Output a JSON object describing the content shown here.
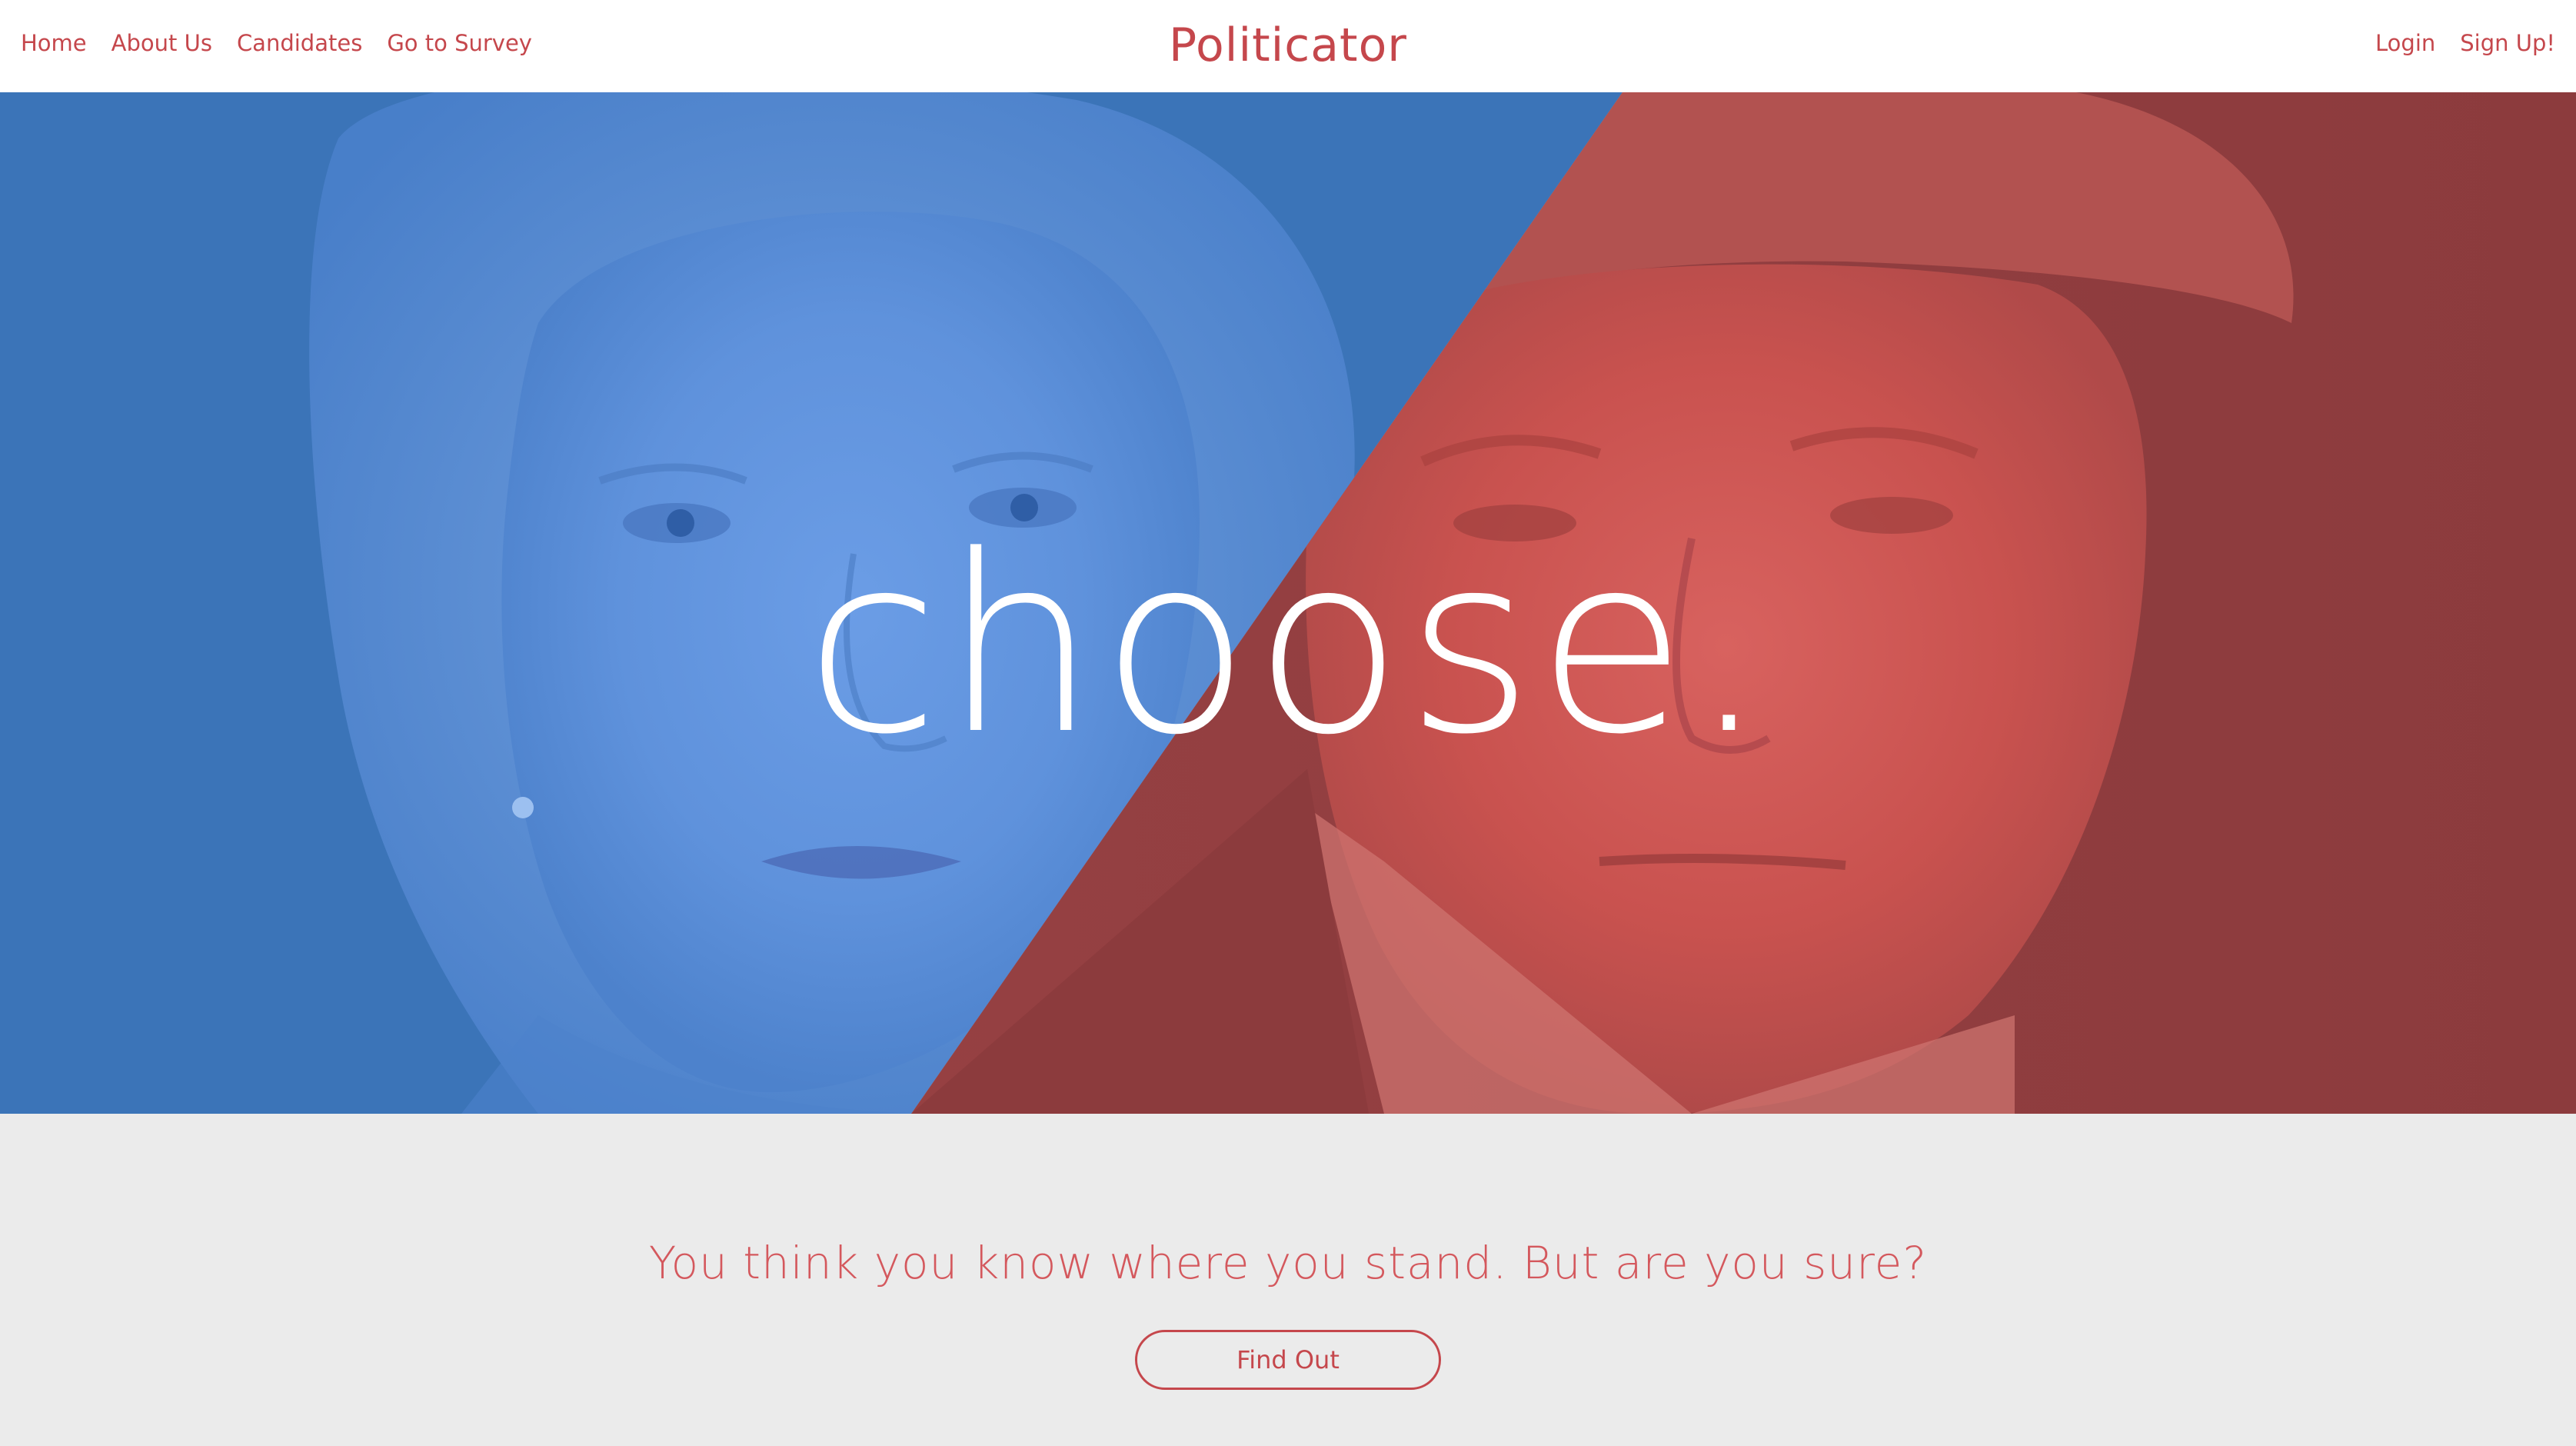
{
  "nav": {
    "left_links": [
      {
        "label": "Home"
      },
      {
        "label": "About Us"
      },
      {
        "label": "Candidates"
      },
      {
        "label": "Go to Survey"
      }
    ],
    "brand": "Politicator",
    "right_links": [
      {
        "label": "Login"
      },
      {
        "label": "Sign Up!"
      }
    ]
  },
  "hero": {
    "headline": "choose.",
    "left_panel": {
      "candidate": "Democratic candidate portrait",
      "tint": "#4a82cc"
    },
    "right_panel": {
      "candidate": "Republican candidate portrait",
      "tint": "#c9504f"
    }
  },
  "cta": {
    "tagline": "You think you know where you stand. But are you sure?",
    "button_label": "Find Out"
  },
  "colors": {
    "accent": "#c5474c",
    "blue": "#3b74b8",
    "red": "#8e3d40",
    "section_bg": "#ebebeb"
  }
}
